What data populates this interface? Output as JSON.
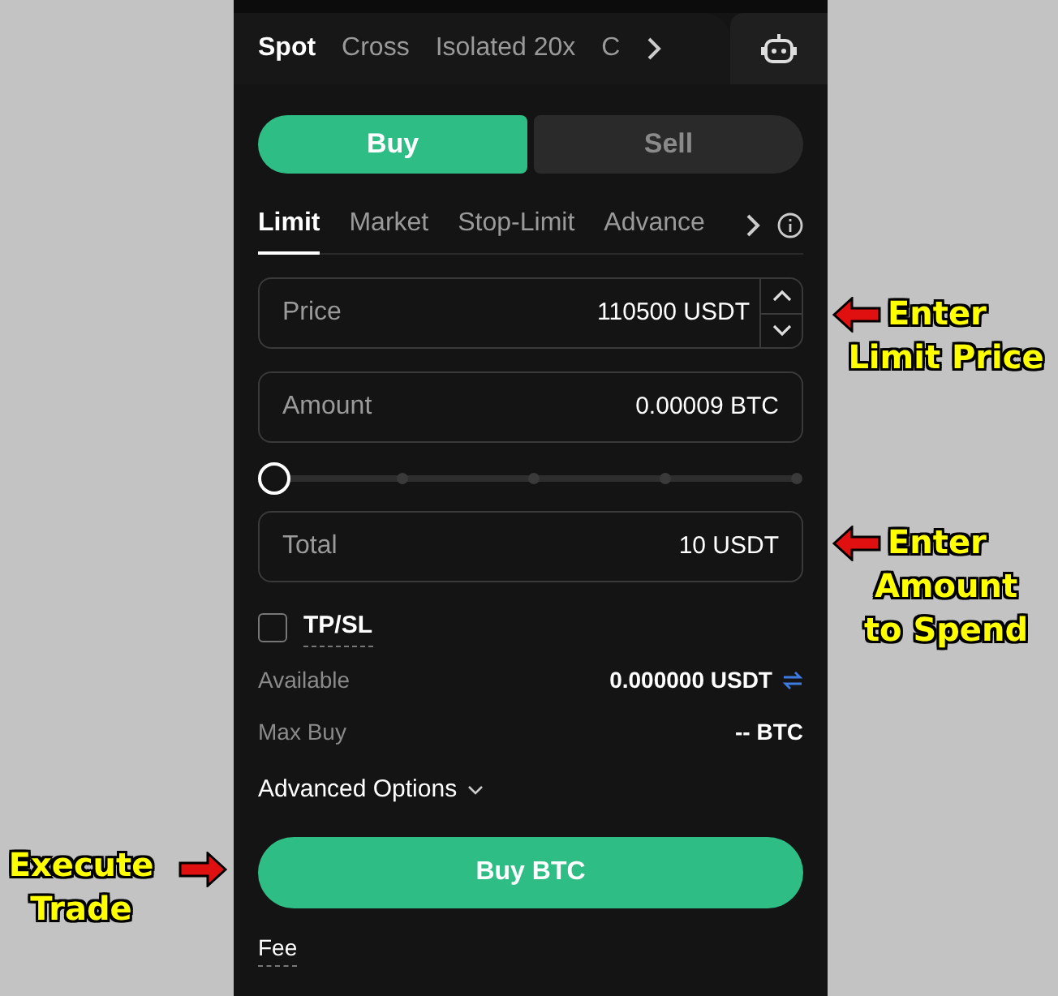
{
  "market_tabs": [
    {
      "label": "Spot",
      "selected": true
    },
    {
      "label": "Cross",
      "selected": false
    },
    {
      "label": "Isolated 20x",
      "selected": false
    },
    {
      "label": "C",
      "selected": false
    }
  ],
  "side_tabs": [
    {
      "label": "Buy",
      "selected": true
    },
    {
      "label": "Sell",
      "selected": false
    }
  ],
  "order_tabs": [
    {
      "label": "Limit",
      "selected": true
    },
    {
      "label": "Market",
      "selected": false
    },
    {
      "label": "Stop-Limit",
      "selected": false
    },
    {
      "label": "Advance",
      "selected": false
    }
  ],
  "fields": [
    {
      "kind": "stepper",
      "label": "Price",
      "value": "110500",
      "unit": "USDT"
    },
    {
      "kind": "plain",
      "label": "Amount",
      "value": "0.00009",
      "unit": "BTC"
    },
    {
      "kind": "plain",
      "label": "Total",
      "value": "10 USDT"
    }
  ],
  "slider": {
    "level": 0
  },
  "tpsl": {
    "label": "TP/SL",
    "checked": false
  },
  "info_rows": [
    {
      "label": "Available",
      "value": "0.000000 USDT",
      "transfer": true
    },
    {
      "label": "Max Buy",
      "value": "-- BTC",
      "transfer": false
    }
  ],
  "advanced_options": "Advanced Options",
  "submit_button": "Buy BTC",
  "fee": "Fee",
  "annotations": [
    {
      "kind": "right",
      "lines": [
        "Enter",
        "Limit Price"
      ]
    },
    {
      "kind": "right",
      "lines": [
        "Enter",
        "Amount",
        "to Spend"
      ]
    },
    {
      "kind": "left",
      "lines": [
        "Execute",
        "Trade"
      ]
    }
  ]
}
